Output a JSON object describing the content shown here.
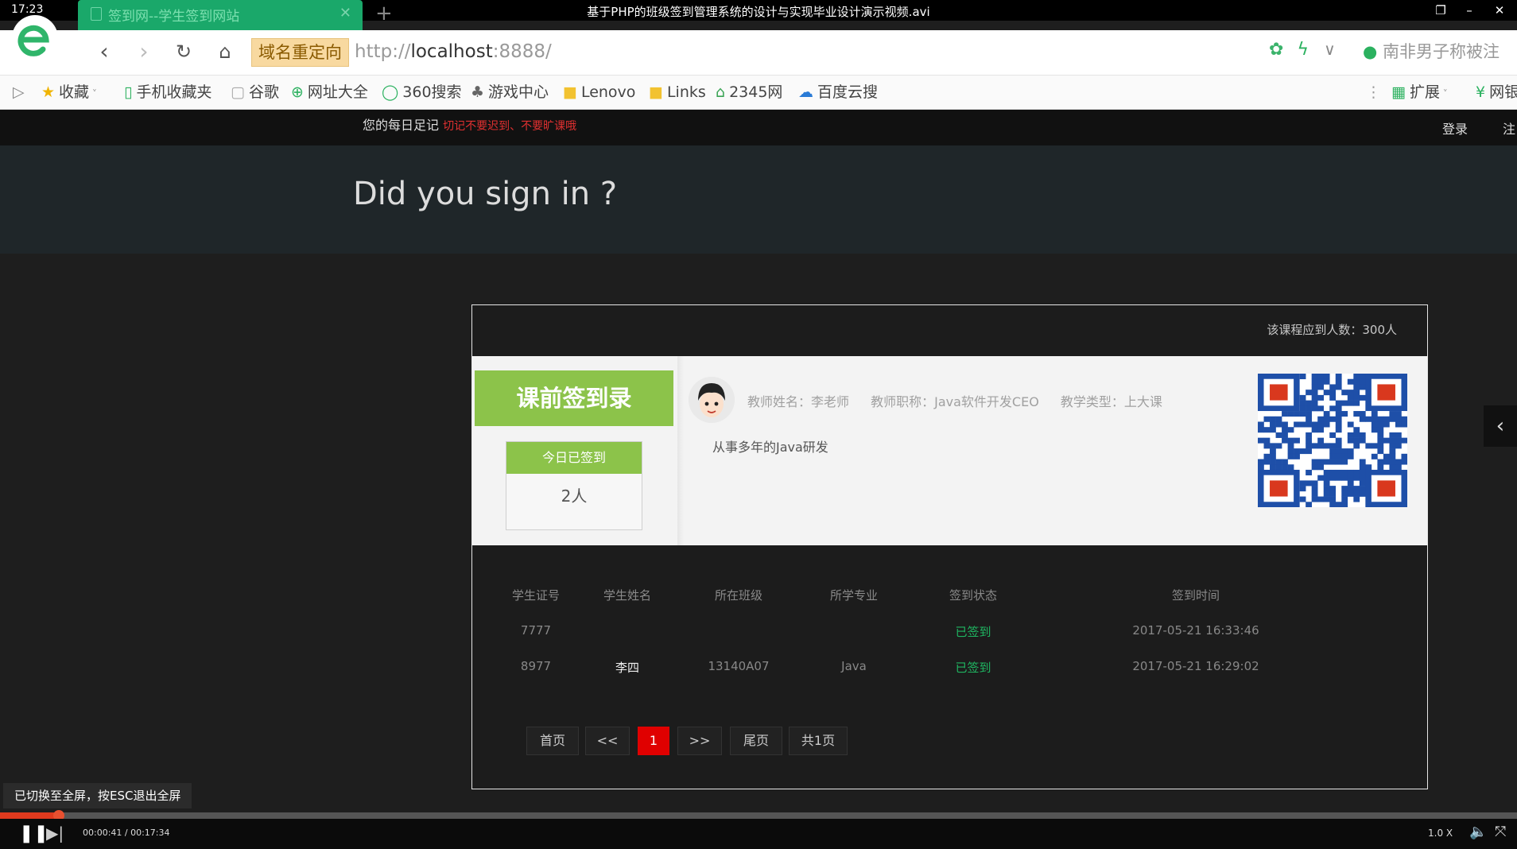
{
  "player": {
    "clock": "17:23",
    "title": "基于PHP的班级签到管理系统的设计与实现毕业设计演示视频.avi",
    "toast": "已切换至全屏，按ESC退出全屏",
    "time": "00:00:41 / 00:17:34",
    "speed": "1.0 X",
    "progress_fraction": 0.039
  },
  "browser": {
    "tab_title": "签到网--学生签到网站",
    "redirect_label": "域名重定向",
    "url_prefix": "http://",
    "url_host": "localhost",
    "url_rest": ":8888/",
    "search_text": "南非男子称被注",
    "bookmarks": [
      {
        "icon": "star-icon",
        "label": "收藏"
      },
      {
        "icon": "phone-icon",
        "label": "手机收藏夹"
      },
      {
        "icon": "doc-icon",
        "label": "谷歌"
      },
      {
        "icon": "plus-circle-icon",
        "label": "网址大全"
      },
      {
        "icon": "search360-icon",
        "label": "360搜索"
      },
      {
        "icon": "gamepad-icon",
        "label": "游戏中心"
      },
      {
        "icon": "folder-icon",
        "label": "Lenovo"
      },
      {
        "icon": "folder-icon",
        "label": "Links"
      },
      {
        "icon": "home-icon",
        "label": "2345网"
      },
      {
        "icon": "cloud-icon",
        "label": "百度云搜"
      }
    ],
    "extensions_label": "扩展",
    "right_cut_label": "网银"
  },
  "site": {
    "motto": "您的每日足记",
    "motto_warning": "切记不要迟到、不要旷课哦",
    "login": "登录",
    "register": "注",
    "hero_title": "Did you sign in ?"
  },
  "panel": {
    "expected_count": "该课程应到人数：300人",
    "card_title": "课前签到录",
    "today_label": "今日已签到",
    "today_count": "2人",
    "teacher_name": "教师姓名：李老师",
    "teacher_title": "教师职称：Java软件开发CEO",
    "teaching_type": "教学类型：上大课",
    "teacher_desc": "从事多年的Java研发",
    "headers": [
      "学生证号",
      "学生姓名",
      "所在班级",
      "所学专业",
      "签到状态",
      "签到时间"
    ],
    "rows": [
      [
        "7777",
        "",
        "",
        "",
        "已签到",
        "2017-05-21 16:33:46"
      ],
      [
        "8977",
        "李四",
        "13140A07",
        "Java",
        "已签到",
        "2017-05-21 16:29:02"
      ]
    ],
    "pagination": {
      "first": "首页",
      "prev": "<<",
      "current": "1",
      "next": ">>",
      "last": "尾页",
      "total": "共1页"
    }
  },
  "colors": {
    "accent_green": "#8cc34a",
    "status_green": "#1fb561",
    "page_active": "#e00000",
    "tab_green": "#1aa86a"
  }
}
